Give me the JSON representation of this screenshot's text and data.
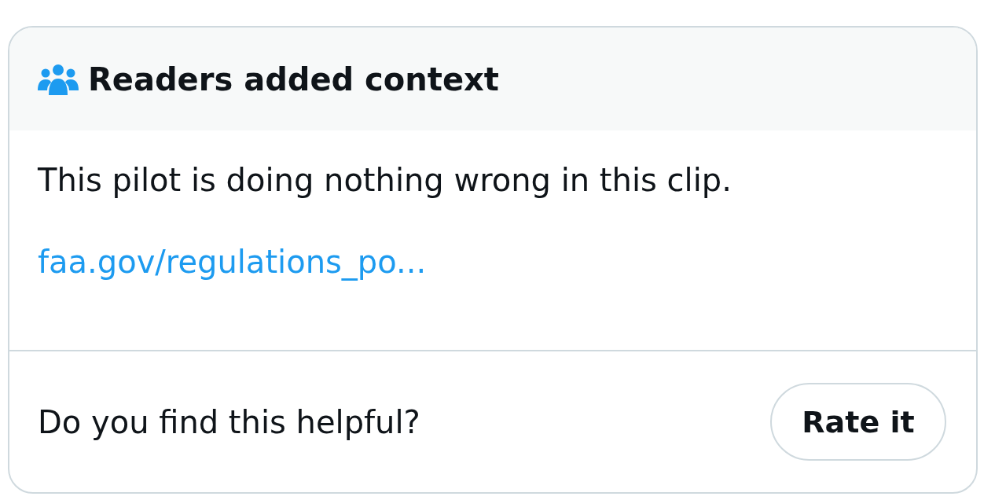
{
  "note": {
    "header": {
      "title": "Readers added context"
    },
    "body": "This pilot is doing nothing wrong in this clip.",
    "link": "faa.gov/regulations_po...",
    "footer": {
      "question": "Do you find this helpful?",
      "button": "Rate it"
    }
  }
}
